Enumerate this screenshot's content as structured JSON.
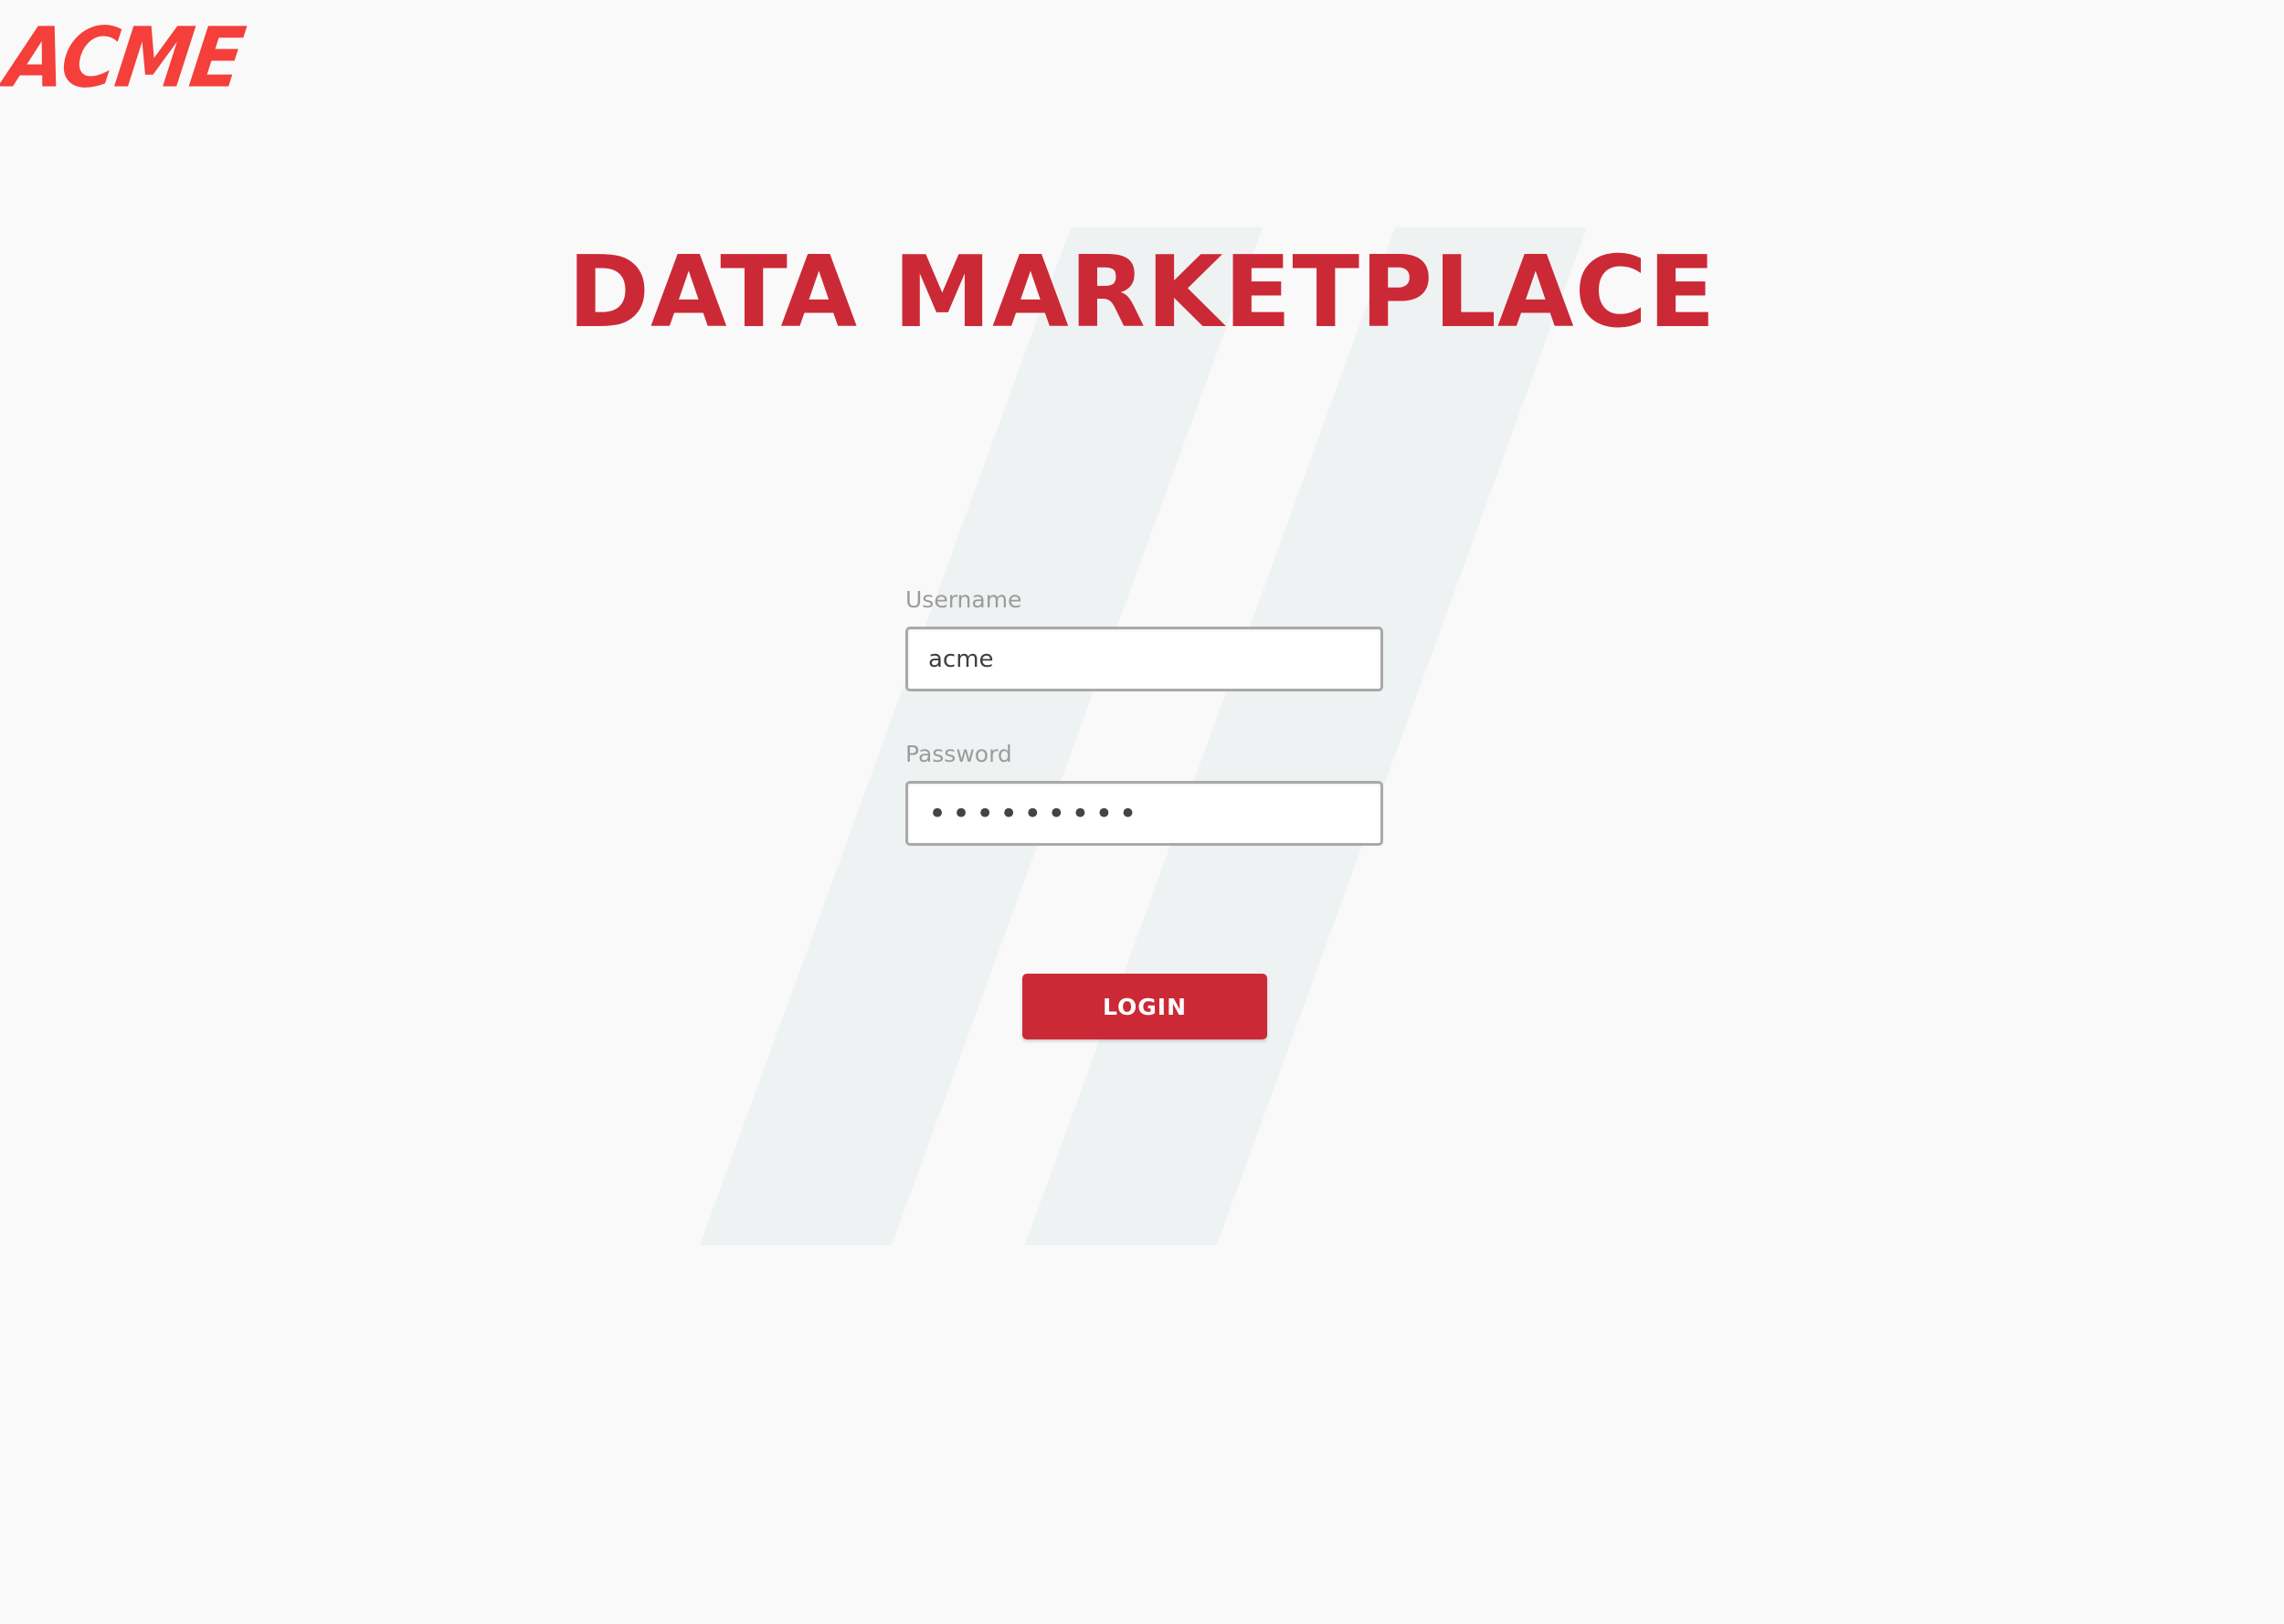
{
  "brand": {
    "logo_text": "ACME",
    "logo_color": "#f43f3a"
  },
  "header": {
    "title": "DATA MARKETPLACE",
    "title_color": "#cc2936"
  },
  "login_form": {
    "username_label": "Username",
    "username_value": "acme",
    "password_label": "Password",
    "password_value": "acmeacme1",
    "login_label": "LOGIN",
    "button_color": "#cc2936"
  },
  "background": {
    "page_color": "#f9f9f9",
    "stripe_color": "#eff2f2"
  }
}
